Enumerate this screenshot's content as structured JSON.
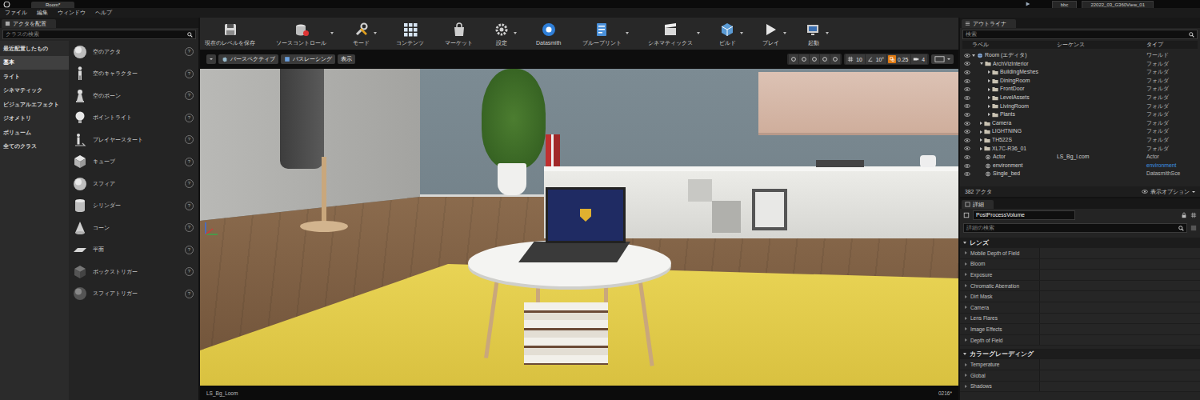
{
  "title_bar": {
    "level_tab": "Room*",
    "project_tabs": [
      "bbc",
      "22022_03_G360View_01"
    ]
  },
  "menu": [
    "ファイル",
    "編集",
    "ウィンドウ",
    "ヘルプ"
  ],
  "place_actors": {
    "tab": "アクタを配置",
    "search_placeholder": "クラスの検索",
    "help_glyph": "?",
    "categories": [
      {
        "label": "最近配置したもの",
        "selected": false
      },
      {
        "label": "基本",
        "selected": true
      },
      {
        "label": "ライト",
        "selected": false
      },
      {
        "label": "シネマティック",
        "selected": false
      },
      {
        "label": "ビジュアルエフェクト",
        "selected": false
      },
      {
        "label": "ジオメトリ",
        "selected": false
      },
      {
        "label": "ボリューム",
        "selected": false
      },
      {
        "label": "全てのクラス",
        "selected": false
      }
    ],
    "items": [
      "空のアクタ",
      "空のキャラクター",
      "空のポーン",
      "ポイントライト",
      "プレイヤースタート",
      "キューブ",
      "スフィア",
      "シリンダー",
      "コーン",
      "平面",
      "ボックストリガー",
      "スフィアトリガー"
    ]
  },
  "toolbar": [
    {
      "label": "現在のレベルを保存",
      "has_menu": false
    },
    {
      "label": "ソースコントロール",
      "has_menu": true
    },
    {
      "label": "モード",
      "has_menu": true
    },
    {
      "label": "コンテンツ",
      "has_menu": false
    },
    {
      "label": "マーケット",
      "has_menu": false
    },
    {
      "label": "設定",
      "has_menu": true
    },
    {
      "label": "Datasmith",
      "has_menu": false
    },
    {
      "label": "ブループリント",
      "has_menu": true
    },
    {
      "label": "シネマティックス",
      "has_menu": true
    },
    {
      "label": "ビルド",
      "has_menu": true
    },
    {
      "label": "プレイ",
      "has_menu": true
    },
    {
      "label": "起動",
      "has_menu": true
    }
  ],
  "viewport": {
    "view_buttons": [
      {
        "label": "パースペクティブ",
        "has_menu": false
      },
      {
        "label": "パスレーシング",
        "has_menu": false
      },
      {
        "label": "表示",
        "has_menu": false
      }
    ],
    "snaps": [
      {
        "value": "10",
        "active": false
      },
      {
        "value": "10°",
        "active": false
      },
      {
        "value": "0.25",
        "active": true
      },
      {
        "value": "4",
        "active": false
      }
    ],
    "level_label": "LS_Bg_Loom",
    "status": "0216*"
  },
  "outliner": {
    "tab": "アウトライナ",
    "search_placeholder": "検索",
    "columns": [
      "ラベル",
      "シーケンス",
      "タイプ"
    ],
    "rows": [
      {
        "label": "Room (エディタ)",
        "sequence": "",
        "type": "ワールド",
        "kind": "world",
        "depth": 0,
        "expanded": true,
        "type_link": false
      },
      {
        "label": "ArchVizInterior",
        "sequence": "",
        "type": "フォルダ",
        "kind": "folder",
        "depth": 1,
        "expanded": true,
        "type_link": false
      },
      {
        "label": "BuildingMeshes",
        "sequence": "",
        "type": "フォルダ",
        "kind": "folder",
        "depth": 2,
        "expanded": false,
        "type_link": false
      },
      {
        "label": "DiningRoom",
        "sequence": "",
        "type": "フォルダ",
        "kind": "folder",
        "depth": 2,
        "expanded": false,
        "type_link": false
      },
      {
        "label": "FrontDoor",
        "sequence": "",
        "type": "フォルダ",
        "kind": "folder",
        "depth": 2,
        "expanded": false,
        "type_link": false
      },
      {
        "label": "LevelAssets",
        "sequence": "",
        "type": "フォルダ",
        "kind": "folder",
        "depth": 2,
        "expanded": false,
        "type_link": false
      },
      {
        "label": "LivingRoom",
        "sequence": "",
        "type": "フォルダ",
        "kind": "folder",
        "depth": 2,
        "expanded": false,
        "type_link": false
      },
      {
        "label": "Plants",
        "sequence": "",
        "type": "フォルダ",
        "kind": "folder",
        "depth": 2,
        "expanded": false,
        "type_link": false
      },
      {
        "label": "Camera",
        "sequence": "",
        "type": "フォルダ",
        "kind": "folder",
        "depth": 1,
        "expanded": false,
        "type_link": false
      },
      {
        "label": "LIGHTNING",
        "sequence": "",
        "type": "フォルダ",
        "kind": "folder",
        "depth": 1,
        "expanded": false,
        "type_link": false
      },
      {
        "label": "TH522S",
        "sequence": "",
        "type": "フォルダ",
        "kind": "folder",
        "depth": 1,
        "expanded": false,
        "type_link": false
      },
      {
        "label": "XL7C-R36_01",
        "sequence": "",
        "type": "フォルダ",
        "kind": "folder",
        "depth": 1,
        "expanded": false,
        "type_link": false
      },
      {
        "label": "Actor",
        "sequence": "LS_Bg_l.com",
        "type": "Actor",
        "kind": "actor",
        "depth": 1,
        "expanded": false,
        "type_link": false
      },
      {
        "label": "environment",
        "sequence": "",
        "type": "environment",
        "kind": "actor",
        "depth": 1,
        "expanded": false,
        "type_link": true
      },
      {
        "label": "Single_bed",
        "sequence": "",
        "type": "DatasmithSce",
        "kind": "actor",
        "depth": 1,
        "expanded": false,
        "type_link": false
      }
    ],
    "count": "382 アクタ",
    "view_options": "表示オプション"
  },
  "details": {
    "tab": "詳細",
    "object_name": "PostProcessVolume",
    "search_placeholder": "詳細の検索",
    "sections": [
      {
        "title": "レンズ",
        "expanded": true,
        "items": [
          {
            "label": "Mobile Depth of Field",
            "expanded": false
          },
          {
            "label": "Bloom",
            "expanded": false
          },
          {
            "label": "Exposure",
            "expanded": false
          },
          {
            "label": "Chromatic Aberration",
            "expanded": false
          },
          {
            "label": "Dirt Mask",
            "expanded": false
          },
          {
            "label": "Camera",
            "expanded": false
          },
          {
            "label": "Lens Flares",
            "expanded": false
          },
          {
            "label": "Image Effects",
            "expanded": false
          },
          {
            "label": "Depth of Field",
            "expanded": false
          }
        ]
      },
      {
        "title": "カラーグレーディング",
        "expanded": true,
        "items": [
          {
            "label": "Temperature",
            "expanded": false
          },
          {
            "label": "Global",
            "expanded": false
          },
          {
            "label": "Shadows",
            "expanded": false
          }
        ]
      }
    ]
  }
}
